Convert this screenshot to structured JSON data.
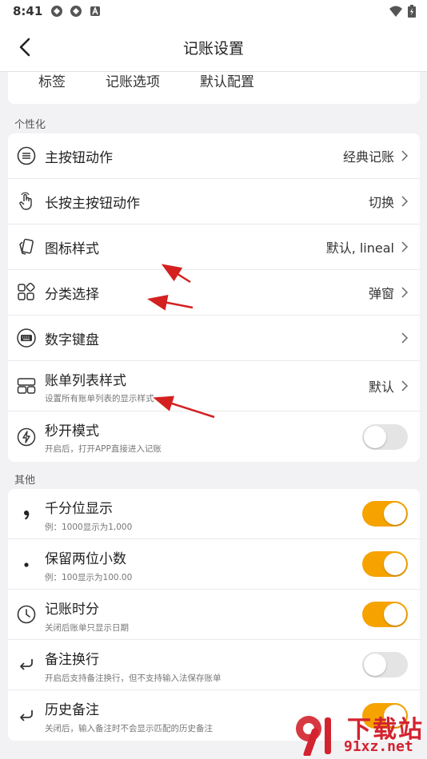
{
  "status_bar": {
    "time": "8:41",
    "icons": [
      "sync-icon",
      "sync-icon",
      "app-a-icon"
    ],
    "right_icons": [
      "wifi-icon",
      "battery-icon"
    ]
  },
  "app_bar": {
    "title": "记账设置",
    "back_icon": "back-arrow-icon"
  },
  "top_tabs": [
    "标签",
    "记账选项",
    "默认配置"
  ],
  "sections": {
    "personalize": {
      "label": "个性化",
      "items": [
        {
          "icon": "list-circle-icon",
          "label": "主按钮动作",
          "value": "经典记账"
        },
        {
          "icon": "long-press-hand-icon",
          "label": "长按主按钮动作",
          "value": "切换"
        },
        {
          "icon": "cards-icon",
          "label": "图标样式",
          "value": "默认, lineal"
        },
        {
          "icon": "category-grid-icon",
          "label": "分类选择",
          "value": "弹窗"
        },
        {
          "icon": "keyboard-icon",
          "label": "数字键盘",
          "value": ""
        },
        {
          "icon": "bill-list-icon",
          "label": "账单列表样式",
          "sub": "设置所有账单列表的显示样式",
          "value": "默认"
        },
        {
          "icon": "lightning-icon",
          "label": "秒开模式",
          "sub": "开启后，打开APP直接进入记账",
          "toggle": false
        }
      ]
    },
    "other": {
      "label": "其他",
      "items": [
        {
          "icon": "comma-icon",
          "label": "千分位显示",
          "sub": "例：1000显示为1,000",
          "toggle": true
        },
        {
          "icon": "dot-icon",
          "label": "保留两位小数",
          "sub": "例：100显示为100.00",
          "toggle": true
        },
        {
          "icon": "clock-icon",
          "label": "记账时分",
          "sub": "关闭后账单只显示日期",
          "toggle": true
        },
        {
          "icon": "return-arrow-icon",
          "label": "备注换行",
          "sub": "开启后支持备注换行，但不支持输入法保存账单",
          "toggle": false
        },
        {
          "icon": "return-arrow-icon",
          "label": "历史备注",
          "sub": "关闭后，输入备注时不会显示匹配的历史备注",
          "toggle": true
        }
      ]
    }
  },
  "watermark": {
    "top": "下载站",
    "bottom": "91xz.net"
  },
  "colors": {
    "accent": "#f6a300",
    "background": "#f2f2f4",
    "annotation_arrow": "#d42020"
  }
}
